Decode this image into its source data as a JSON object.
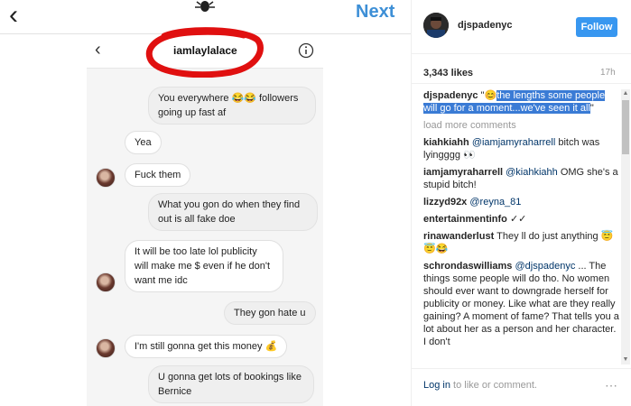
{
  "dm_screen": {
    "outer_back_glyph": "‹",
    "next_label": "Next",
    "header_back_glyph": "‹",
    "username": "iamlaylalace",
    "info_glyph": "i",
    "messages": [
      {
        "side": "sent",
        "text": "You everywhere 😂😂 followers going up fast af"
      },
      {
        "side": "received",
        "text": "Yea"
      },
      {
        "side": "received",
        "text": "Fuck them"
      },
      {
        "side": "sent",
        "text": "What you gon do when they find out is all fake doe"
      },
      {
        "side": "received",
        "text": "It will be too late lol publicity will make me $ even if he don't want me idc"
      },
      {
        "side": "sent",
        "text": "They gon hate u"
      },
      {
        "side": "received",
        "text": "I'm still gonna get this money 💰"
      },
      {
        "side": "sent",
        "text": "U gonna get lots of bookings like Bernice"
      }
    ]
  },
  "post": {
    "username": "djspadenyc",
    "follow_label": "Follow",
    "likes": "3,343 likes",
    "age": "17h",
    "caption": {
      "user": "djspadenyc",
      "prefix": " \"😊",
      "highlighted": "the lengths some people will go for a moment...we've seen it all",
      "suffix": "\""
    },
    "load_more": "load more comments",
    "comments": [
      {
        "user": "kiahkiahh",
        "mention": "@iamjamyraharrell",
        "text": " bitch was lyingggg 👀"
      },
      {
        "user": "iamjamyraharrell",
        "mention": "@kiahkiahh",
        "text": " OMG she's a stupid bitch!"
      },
      {
        "user": "lizzyd92x",
        "mention": "@reyna_81",
        "text": ""
      },
      {
        "user": "entertainmentinfo",
        "mention": "",
        "text": "✓✓"
      },
      {
        "user": "rinawanderlust",
        "mention": "",
        "text": "They ll do just anything 😇😇😂"
      },
      {
        "user": "schrondaswilliams",
        "mention": "@djspadenyc",
        "text": " ... The things some people will do tho. No women should ever want to downgrade herself for publicity or money. Like what are they really gaining? A moment of fame? That tells you a lot about her as a person and her character. I don't"
      }
    ],
    "footer": {
      "login": "Log in",
      "rest": " to like or comment.",
      "more_glyph": "⋯"
    }
  },
  "colors": {
    "accent": "#3897f0",
    "next": "#3d8fd6",
    "circle": "#e01010",
    "highlight": "#3a7bd5"
  }
}
